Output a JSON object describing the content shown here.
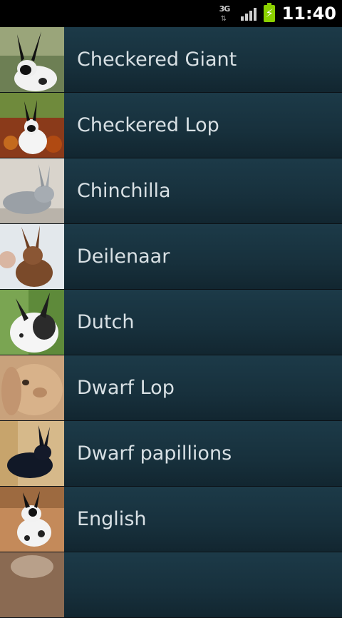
{
  "status_bar": {
    "network": "3G",
    "clock": "11:40",
    "icons": [
      "network-3g-icon",
      "signal-strength-icon",
      "battery-charging-icon"
    ]
  },
  "breeds": [
    {
      "label": "Checkered Giant",
      "thumb": "rabbit-photo"
    },
    {
      "label": "Checkered Lop",
      "thumb": "rabbit-photo"
    },
    {
      "label": "Chinchilla",
      "thumb": "rabbit-photo"
    },
    {
      "label": "Deilenaar",
      "thumb": "rabbit-photo"
    },
    {
      "label": "Dutch",
      "thumb": "rabbit-photo"
    },
    {
      "label": "Dwarf Lop",
      "thumb": "rabbit-photo"
    },
    {
      "label": "Dwarf papillions",
      "thumb": "rabbit-photo"
    },
    {
      "label": "English",
      "thumb": "rabbit-photo"
    },
    {
      "label": "",
      "thumb": "rabbit-photo"
    }
  ]
}
